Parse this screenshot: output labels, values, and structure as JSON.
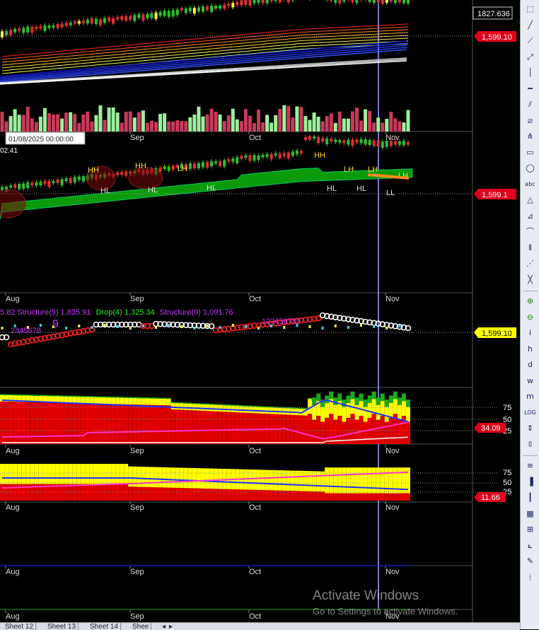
{
  "colors": {
    "background": "#000000",
    "up": "#15a015",
    "down": "#e23030",
    "cursor": "#8c8cff",
    "price_tag": "#e0001b",
    "yellow_tag": "#ffff00"
  },
  "axis_months": [
    "Aug",
    "Sep",
    "Oct",
    "Nov"
  ],
  "pane1": {
    "top_value": "1827.636",
    "price_tag": "1,599.10",
    "cursor_date": "01/08/2025 00:00:00"
  },
  "pane2": {
    "corner_value": "02.41",
    "price_tag": "1,599.1",
    "swing_labels": [
      "HH",
      "HL",
      "HH",
      "HL",
      "LH",
      "HL",
      "HH",
      "HL",
      "LH",
      "HL",
      "LH",
      "LL",
      "LH"
    ]
  },
  "pane3": {
    "legend_a": "5.82 Structure(9) 1,835.91",
    "legend_b": "Drop(4) 1,325.34",
    "legend_c": "Structure(9) 1,091.76",
    "count_left": "2345678",
    "count_left_9": "9",
    "count_right": "123456789",
    "price_tag": "1,599.10"
  },
  "pane4": {
    "levels": [
      "75",
      "50",
      "25"
    ],
    "value_tag": "34.09"
  },
  "pane5": {
    "levels": [
      "75",
      "50",
      "25"
    ],
    "value_tag": "11.66"
  },
  "sheet_tabs": [
    "Sheet 12",
    "Sheet 13",
    "Sheet 14",
    "Shee"
  ],
  "watermark": {
    "line1": "Activate Windows",
    "line2": "Go to Settings to activate Windows."
  },
  "toolbar": [
    {
      "icon": "cursor-icon",
      "glyph": "⬚"
    },
    {
      "icon": "line-icon",
      "glyph": "╱"
    },
    {
      "icon": "ray-icon",
      "glyph": "⟋"
    },
    {
      "icon": "extended-line-icon",
      "glyph": "⤢"
    },
    {
      "icon": "vertical-line-icon",
      "glyph": "│"
    },
    {
      "icon": "horizontal-line-icon",
      "glyph": "━"
    },
    {
      "icon": "parallel-lines-icon",
      "glyph": "⫽"
    },
    {
      "icon": "channel-icon",
      "glyph": "⧄"
    },
    {
      "icon": "pitchfork-icon",
      "glyph": "⋔"
    },
    {
      "icon": "rectangle-icon",
      "glyph": "▭"
    },
    {
      "icon": "ellipse-icon",
      "glyph": "◯"
    },
    {
      "icon": "text-icon",
      "glyph": "abc"
    },
    {
      "icon": "triangle-icon",
      "glyph": "△"
    },
    {
      "icon": "fibonacci-icon",
      "glyph": "⊿"
    },
    {
      "icon": "arc-icon",
      "glyph": "⌒"
    },
    {
      "icon": "cycles-icon",
      "glyph": "⦀"
    },
    {
      "icon": "pattern-icon",
      "glyph": "⋰"
    },
    {
      "icon": "gann-icon",
      "glyph": "╳"
    },
    {
      "icon": "zoom-in-icon",
      "glyph": "⊕"
    },
    {
      "icon": "zoom-out-icon",
      "glyph": "⊖"
    },
    {
      "icon": "italic-icon",
      "glyph": "i"
    },
    {
      "icon": "hourly-icon",
      "glyph": "h"
    },
    {
      "icon": "daily-icon",
      "glyph": "d"
    },
    {
      "icon": "weekly-icon",
      "glyph": "w"
    },
    {
      "icon": "monthly-icon",
      "glyph": "m"
    },
    {
      "icon": "log-icon",
      "glyph": "LOG"
    },
    {
      "icon": "expand-icon",
      "glyph": "⇕"
    },
    {
      "icon": "fit-icon",
      "glyph": "⇳"
    },
    {
      "icon": "layers-icon",
      "glyph": "≡"
    },
    {
      "icon": "bars-icon",
      "glyph": "▐"
    },
    {
      "icon": "candles-icon",
      "glyph": "┃"
    },
    {
      "icon": "grid-icon",
      "glyph": "▦"
    },
    {
      "icon": "table-icon",
      "glyph": "⊞"
    },
    {
      "icon": "fan-icon",
      "glyph": "⟀"
    },
    {
      "icon": "pen-icon",
      "glyph": "✎"
    },
    {
      "icon": "columns-icon",
      "glyph": "⦙"
    }
  ]
}
